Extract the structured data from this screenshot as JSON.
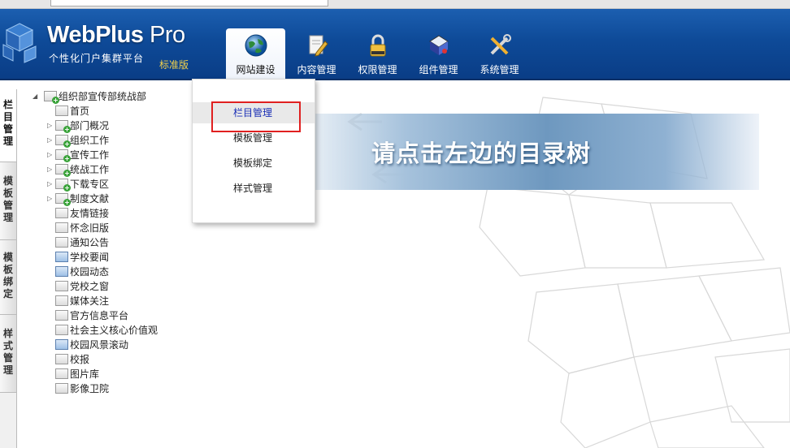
{
  "brand": {
    "name_main": "WebPlus",
    "name_suffix": " Pro",
    "tagline": "个性化门户集群平台",
    "edition": "标准版"
  },
  "nav": [
    {
      "label": "网站建设",
      "icon": "globe-icon",
      "active": true
    },
    {
      "label": "内容管理",
      "icon": "document-edit-icon"
    },
    {
      "label": "权限管理",
      "icon": "lock-icon"
    },
    {
      "label": "组件管理",
      "icon": "component-icon"
    },
    {
      "label": "系统管理",
      "icon": "tools-icon"
    }
  ],
  "dropdown": [
    "栏目管理",
    "模板管理",
    "模板绑定",
    "样式管理"
  ],
  "side_tabs": [
    "栏目管理",
    "模板管理",
    "模板绑定",
    "样式管理"
  ],
  "tree": {
    "root": "组织部宣传部统战部",
    "children": [
      "首页",
      "部门概况",
      "组织工作",
      "宣传工作",
      "统战工作",
      "下载专区",
      "制度文献",
      "友情链接",
      "怀念旧版",
      "通知公告",
      "学校要闻",
      "校园动态",
      "党校之窗",
      "媒体关注",
      "官方信息平台",
      "社会主义核心价值观",
      "校园风景滚动",
      "校报",
      "图片库",
      "影像卫院"
    ]
  },
  "banner": {
    "text": "请点击左边的目录树"
  },
  "colors": {
    "header": "#0e4a98",
    "highlight_box": "#e02020",
    "edition": "#f3d24a"
  }
}
